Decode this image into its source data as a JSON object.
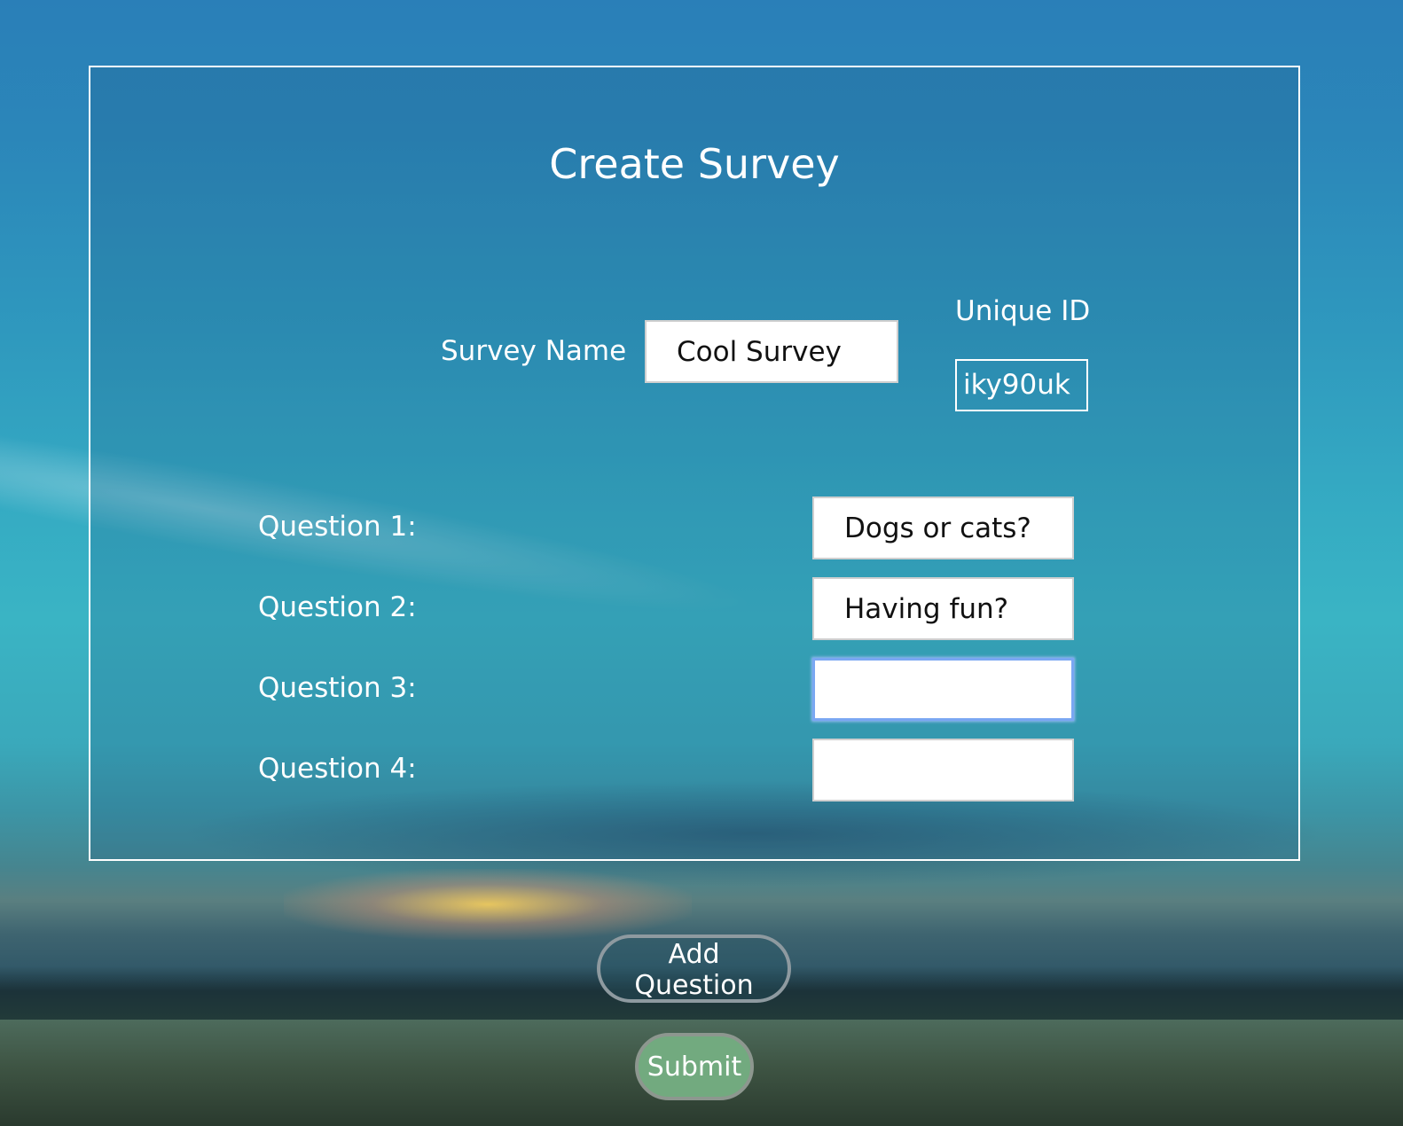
{
  "page": {
    "title": "Create Survey"
  },
  "survey_name": {
    "label": "Survey Name",
    "value": "Cool Survey"
  },
  "unique_id": {
    "label": "Unique ID",
    "value": "iky90uk"
  },
  "questions": [
    {
      "label": "Question 1:",
      "value": "Dogs or cats?"
    },
    {
      "label": "Question 2:",
      "value": "Having fun?"
    },
    {
      "label": "Question 3:",
      "value": ""
    },
    {
      "label": "Question 4:",
      "value": ""
    }
  ],
  "actions": {
    "add_question_label": "Add Question",
    "submit_label": "Submit"
  },
  "colors": {
    "submit_button": "#72aa7f",
    "focus_ring": "#7aa7f2",
    "frame_border": "#ffffff"
  }
}
